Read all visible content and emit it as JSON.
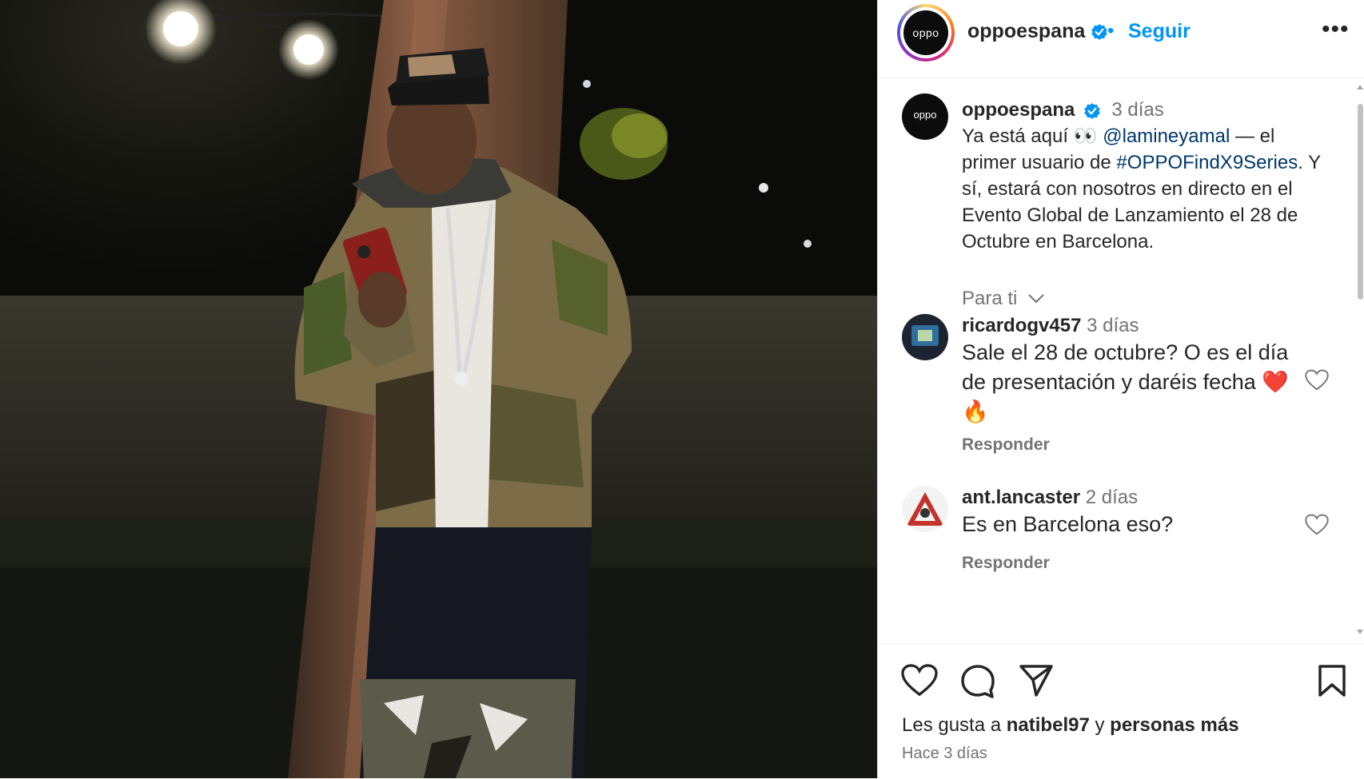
{
  "post": {
    "username": "oppoespana",
    "avatar_text": "oppo",
    "follow_label": "Seguir",
    "separator": "•",
    "more_label": "•••"
  },
  "caption": {
    "username": "oppoespana",
    "time": "3 días",
    "text_1": "Ya está aquí 👀 ",
    "mention": "@lamineyamal",
    "text_2": " — el primer usuario de ",
    "hashtag": "#OPPOFindX9Series",
    "text_3": ". Y sí, estará con nosotros en directo en el Evento Global de Lanzamiento el 28 de Octubre en Barcelona."
  },
  "filter": {
    "label": "Para ti"
  },
  "comments": [
    {
      "username": "ricardogv457",
      "time": "3 días",
      "text": "Sale el 28 de octubre? O es el día de presentación y daréis fecha ❤️ 🔥",
      "reply_label": "Responder"
    },
    {
      "username": "ant.lancaster",
      "time": "2 días",
      "text": "Es en Barcelona eso?",
      "reply_label": "Responder"
    }
  ],
  "likes": {
    "prefix": "Les gusta a ",
    "user": "natibel97",
    "middle": " y ",
    "rest": "personas más"
  },
  "posted": "Hace 3 días",
  "colors": {
    "accent": "#0095f6",
    "link": "#00376b",
    "muted": "#737373",
    "verified": "#0095f6"
  },
  "icons": [
    "verified-icon",
    "more-icon",
    "chevron-down-icon",
    "heart-icon",
    "comment-icon",
    "share-icon",
    "bookmark-icon"
  ]
}
